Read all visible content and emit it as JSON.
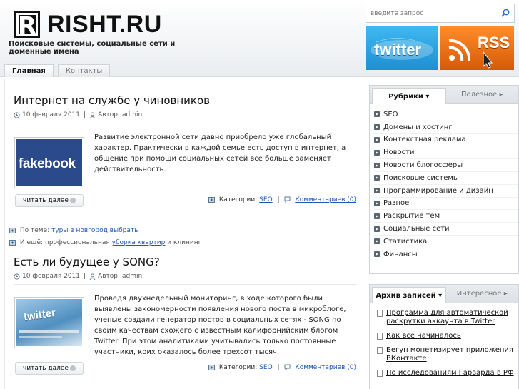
{
  "site": {
    "logo_letter": "R",
    "logo_text": "RISHT.RU",
    "tagline": "Поисковые системы, социальные сети и доменные имена"
  },
  "nav": {
    "tabs": [
      {
        "label": "Главная",
        "active": true
      },
      {
        "label": "Контакты",
        "active": false
      }
    ]
  },
  "search": {
    "placeholder": "введите запрос"
  },
  "badges": {
    "twitter": "twitter",
    "rss": "RSS"
  },
  "posts": [
    {
      "title": "Интернет на службе у чиновников",
      "date": "10 февраля 2011",
      "author_label": "Автор:",
      "author": "admin",
      "thumb_text": "fakebook",
      "excerpt": "Развитие электронной сети давно приобрело уже глобальный характер. Практически в каждой семье есть доступ в интернет, а общение при помощи социальных сетей все больше заменяет действительность.",
      "readmore": "читать далее",
      "categories_label": "Категории:",
      "category": "SEO",
      "comments": "Комментариев (0)"
    },
    {
      "title": "Есть ли будущее у SONG?",
      "date": "10 февраля 2011",
      "author_label": "Автор:",
      "author": "admin",
      "thumb_text": "twitter",
      "excerpt": "Проведя двухнедельный мониторинг, в ходе которого были выявлены закономерности появления нового поста в микроблоге, ученые создали генератор постов в социальных сетях - SONG по своим качествам схожего с известным калифорнийским блогом Twitter. При этом аналитиками учитывались только постоянные участники, коих оказалось более трехсот тысяч.",
      "readmore": "читать далее",
      "categories_label": "Категории:",
      "category": "SEO",
      "comments": "Комментариев (0)"
    }
  ],
  "related": {
    "topic_label": "По теме:",
    "topic_link": "туры в новгород выбрать",
    "more_label": "И ещё:",
    "more_text": "профессиональная",
    "more_link": "уборка квартир",
    "more_suffix": "и клининг"
  },
  "sidebar": {
    "widget1": {
      "tab_active": "Рубрики",
      "tab_inactive": "Полезное",
      "items": [
        "SEO",
        "Домены и хостинг",
        "Контекстная реклама",
        "Новости",
        "Новости блогосферы",
        "Поисковые системы",
        "Программирование и дизайн",
        "Разное",
        "Раскрытие тем",
        "Социальные сети",
        "Статистика",
        "Финансы"
      ]
    },
    "widget2": {
      "tab_active": "Архив записей",
      "tab_inactive": "Интересное",
      "items": [
        "Программа для автоматической раскрутки аккаунта в Twitter",
        "Как все начиналось",
        "Бегун монетизирует приложения ВКонтакте",
        "По исследованиям Гарварда в РФ"
      ]
    }
  }
}
